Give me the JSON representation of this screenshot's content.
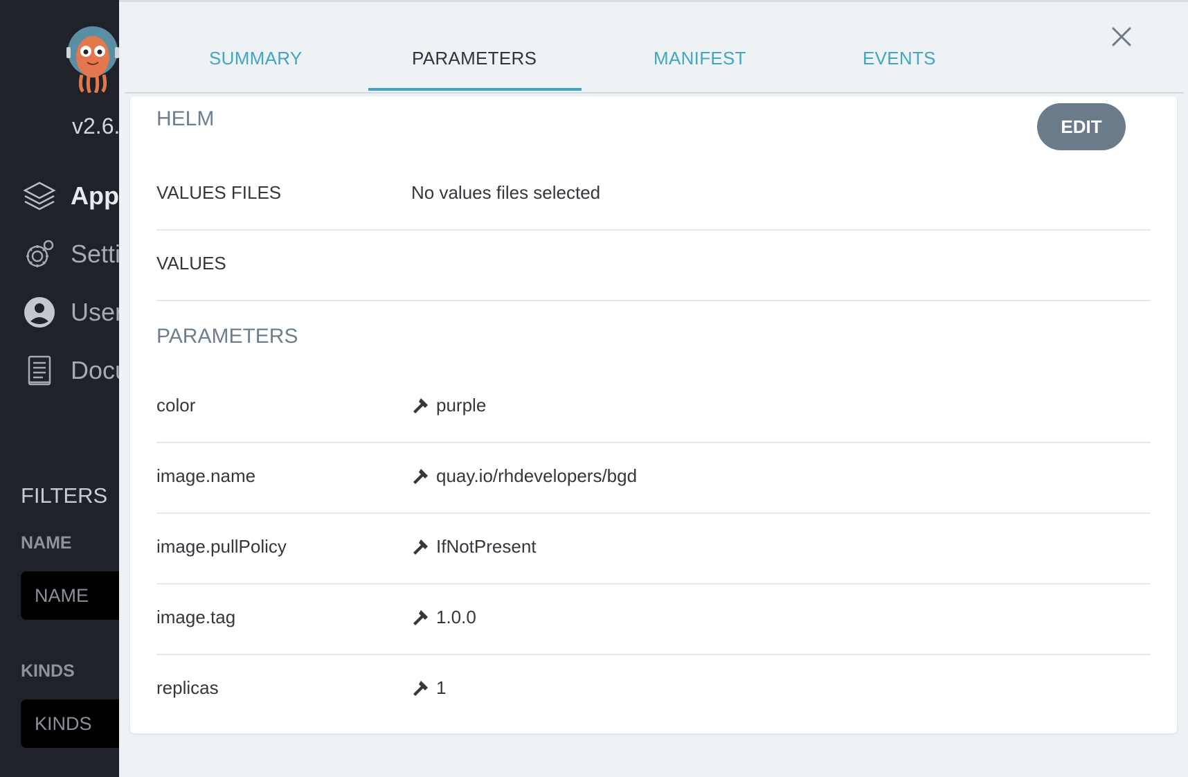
{
  "sidebar": {
    "version": "v2.6.",
    "nav": [
      {
        "label": "Appl",
        "icon": "layers-icon"
      },
      {
        "label": "Setti",
        "icon": "gear-icon"
      },
      {
        "label": "User",
        "icon": "user-circle-icon"
      },
      {
        "label": "Docu",
        "icon": "book-icon"
      }
    ],
    "filters_title": "FILTERS",
    "name_label": "NAME",
    "name_placeholder": "NAME",
    "kinds_label": "KINDS",
    "kinds_placeholder": "KINDS"
  },
  "tabs": [
    {
      "label": "SUMMARY",
      "active": false
    },
    {
      "label": "PARAMETERS",
      "active": true
    },
    {
      "label": "MANIFEST",
      "active": false
    },
    {
      "label": "EVENTS",
      "active": false
    }
  ],
  "colors": {
    "accent": "#42a6c1",
    "sidebar": "#1f2229",
    "edit_button": "#6c7b89"
  },
  "helm": {
    "title": "HELM",
    "edit_label": "EDIT",
    "values_files_key": "VALUES FILES",
    "values_files_value": "No values files selected",
    "values_key": "VALUES"
  },
  "parameters": {
    "title": "PARAMETERS",
    "rows": [
      {
        "key": "color",
        "value": "purple"
      },
      {
        "key": "image.name",
        "value": "quay.io/rhdevelopers/bgd"
      },
      {
        "key": "image.pullPolicy",
        "value": "IfNotPresent"
      },
      {
        "key": "image.tag",
        "value": "1.0.0"
      },
      {
        "key": "replicas",
        "value": "1"
      }
    ]
  }
}
